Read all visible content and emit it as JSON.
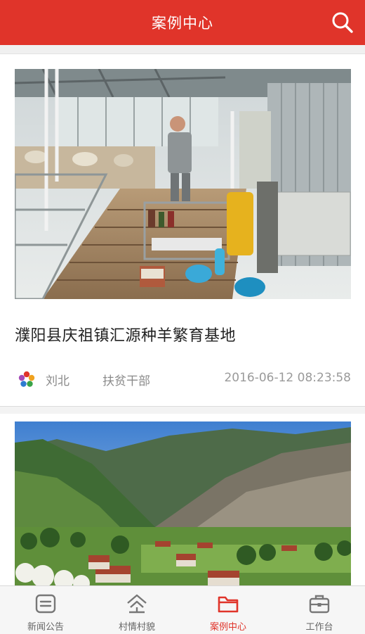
{
  "header": {
    "title": "案例中心",
    "search_icon": "search-icon"
  },
  "cases": [
    {
      "title": "濮阳县庆祖镇汇源种羊繁育基地",
      "author": "刘北",
      "role": "扶贫干部",
      "time": "2016-06-12 08:23:58",
      "image": "sheep-breeding-barn-photo"
    },
    {
      "image": "mountain-village-photo"
    }
  ],
  "tabbar": {
    "items": [
      {
        "label": "新闻公告",
        "icon": "news-icon",
        "active": false
      },
      {
        "label": "村情村貌",
        "icon": "village-icon",
        "active": false
      },
      {
        "label": "案例中心",
        "icon": "folder-icon",
        "active": true
      },
      {
        "label": "工作台",
        "icon": "briefcase-icon",
        "active": false
      }
    ]
  },
  "colors": {
    "brand_red": "#e0342a",
    "meta_gray": "#8a8a8a"
  }
}
